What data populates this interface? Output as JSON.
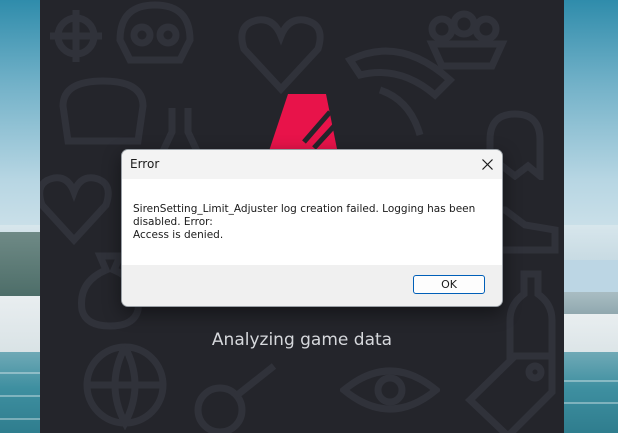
{
  "launcher": {
    "status_text": "Analyzing game data",
    "background_color": "#24252b",
    "logo_color": "#e8134a"
  },
  "dialog": {
    "title": "Error",
    "message": "SirenSetting_Limit_Adjuster log creation failed. Logging has been\ndisabled. Error:\nAccess is denied.",
    "ok_label": "OK",
    "close_icon": "close-icon",
    "accent_color": "#005fb8"
  }
}
